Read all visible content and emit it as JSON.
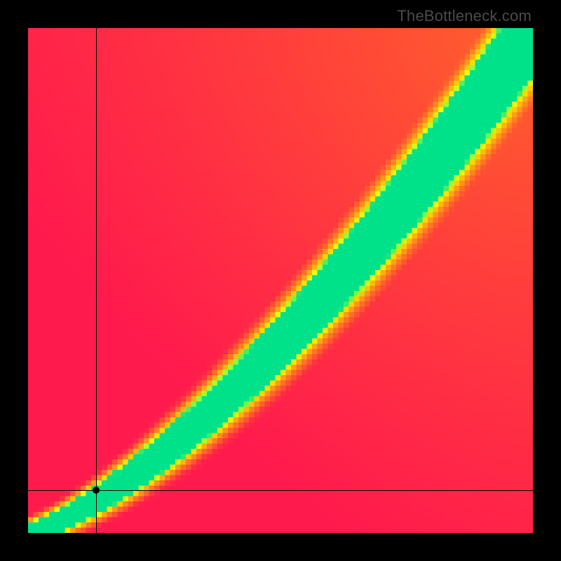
{
  "watermark": "TheBottleneck.com",
  "chart_data": {
    "type": "heatmap",
    "title": "",
    "xlabel": "",
    "ylabel": "",
    "xlim": [
      0,
      1
    ],
    "ylim": [
      0,
      1
    ],
    "grid_size": 96,
    "ideal_curve": {
      "description": "y ≈ 0.22*x + 0.78*x^1.55 (green optimal band diagonal)",
      "a_linear": 0.22,
      "a_power": 0.78,
      "power_exp": 1.55
    },
    "band_half_width": {
      "base": 0.018,
      "growth": 0.075
    },
    "score_falloff": 2.3,
    "corner_bias": {
      "target_x": 1.0,
      "target_y": 1.0,
      "strength": 0.32
    },
    "color_stops": [
      {
        "t": 0.0,
        "hex": "#ff1a4d"
      },
      {
        "t": 0.3,
        "hex": "#ff5d2d"
      },
      {
        "t": 0.55,
        "hex": "#ff9c1a"
      },
      {
        "t": 0.75,
        "hex": "#ffd400"
      },
      {
        "t": 0.88,
        "hex": "#e8ff10"
      },
      {
        "t": 0.95,
        "hex": "#8dff3a"
      },
      {
        "t": 1.0,
        "hex": "#00e28a"
      }
    ],
    "marker": {
      "x": 0.135,
      "y": 0.085
    },
    "crosshair": {
      "x": 0.135,
      "y": 0.085
    }
  }
}
